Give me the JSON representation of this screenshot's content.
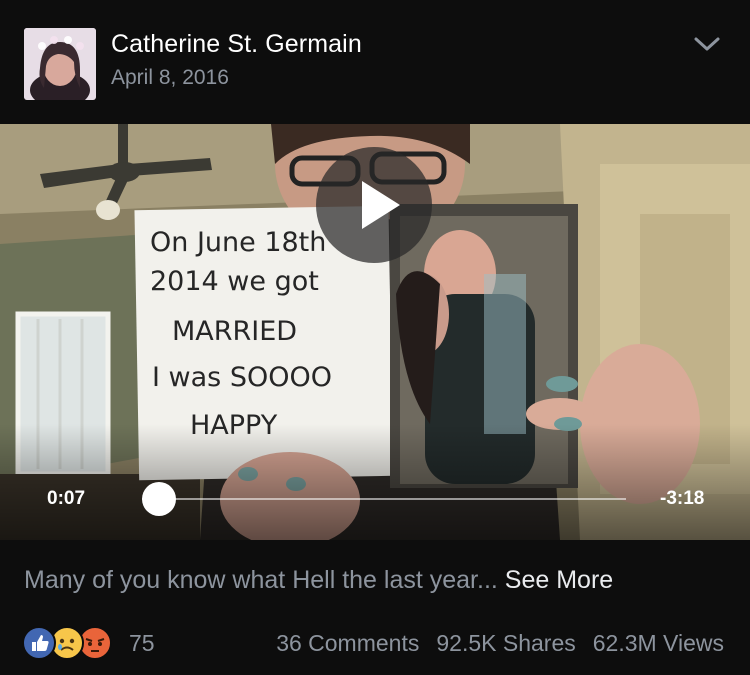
{
  "post": {
    "author_name": "Catherine St. Germain",
    "date": "April 8, 2016",
    "menu_icon": "chevron-down-icon"
  },
  "video": {
    "elapsed": "0:07",
    "remaining": "-3:18",
    "progress_fraction": 0.035,
    "card_text": [
      "On June 18th",
      "2014 we got",
      "MARRIED",
      "I was SOOOO",
      "HAPPY"
    ]
  },
  "caption": {
    "text": "Many of you know what Hell the last year... ",
    "see_more": "See More"
  },
  "footer": {
    "reaction_icons": [
      "like-icon",
      "sad-icon",
      "angry-icon"
    ],
    "reaction_count": "75",
    "comments": "36 Comments",
    "shares": "92.5K Shares",
    "views": "62.3M Views"
  }
}
